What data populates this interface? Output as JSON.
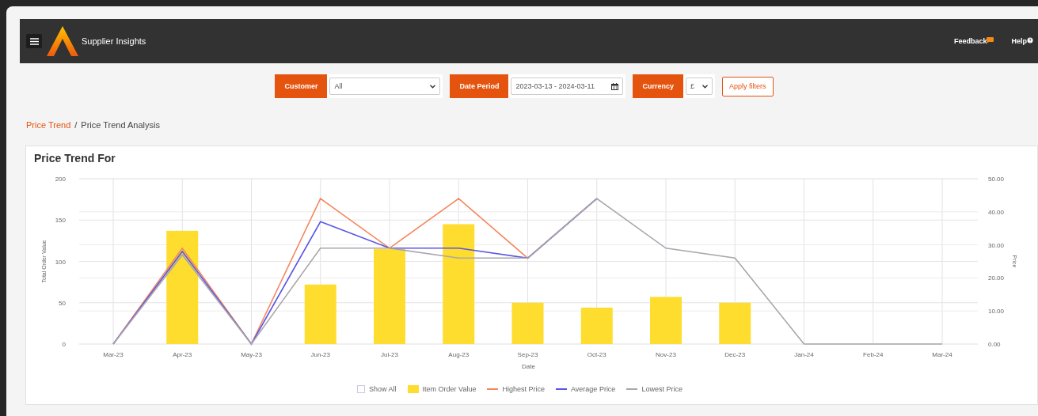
{
  "header": {
    "title": "Supplier Insights",
    "links": [
      {
        "label": "Feedback",
        "kind": "feedback"
      },
      {
        "label": "Help",
        "kind": "help"
      }
    ]
  },
  "filters": [
    {
      "label": "Customer",
      "kind": "select",
      "value": "All"
    },
    {
      "label": "Date Period",
      "kind": "date",
      "value": "2023-03-13 - 2024-03-11"
    },
    {
      "label": "Currency",
      "kind": "select",
      "value": "£"
    }
  ],
  "apply_button": "Apply filters",
  "breadcrumb": {
    "separator": "/",
    "items": [
      {
        "label": "Price Trend",
        "kind": "link"
      },
      {
        "label": "Price Trend Analysis",
        "kind": "current"
      }
    ]
  },
  "card": {
    "title": "Price Trend For",
    "show_all": {
      "label": "Show All",
      "checked": false
    },
    "chart_data": {
      "type": "bar",
      "xlabel": "Date",
      "ylabel": "Total Order Value",
      "y2label": "Price",
      "categories": [
        "Mar-23",
        "Apr-23",
        "May-23",
        "Jun-23",
        "Jul-23",
        "Aug-23",
        "Sep-23",
        "Oct-23",
        "Nov-23",
        "Dec-23",
        "Jan-24",
        "Feb-24",
        "Mar-24"
      ],
      "grid": true,
      "ylim": [
        0,
        200
      ],
      "yticks": [
        0,
        50,
        100,
        150,
        200
      ],
      "y2lim": [
        0,
        50
      ],
      "y2ticks": [
        {
          "value": 0,
          "label": "0.00"
        },
        {
          "value": 10,
          "label": "10.00"
        },
        {
          "value": 20,
          "label": "20.00"
        },
        {
          "value": 30,
          "label": "30.00"
        },
        {
          "value": 40,
          "label": "40.00"
        },
        {
          "value": 50,
          "label": "50.00"
        }
      ],
      "series": [
        {
          "name": "Item Order Value",
          "color": "#fedd2f",
          "values": [
            null,
            137,
            null,
            72,
            115,
            145,
            50,
            44,
            57,
            50,
            null,
            null,
            null
          ]
        },
        {
          "name": "Highest Price",
          "type": "line",
          "axis": "y2",
          "color": "#f5875c",
          "values": [
            0,
            29,
            0,
            44,
            29,
            44,
            26,
            44,
            null,
            null,
            null,
            null,
            null
          ]
        },
        {
          "name": "Average Price",
          "type": "line",
          "axis": "y2",
          "color": "#5a55e6",
          "values": [
            0,
            28,
            0,
            37,
            29,
            29,
            26,
            44,
            null,
            null,
            null,
            null,
            null
          ]
        },
        {
          "name": "Lowest Price",
          "type": "line",
          "axis": "y2",
          "color": "#a9a6ad",
          "values": [
            0,
            27,
            0,
            29,
            29,
            26,
            26,
            44,
            29,
            26,
            0,
            0,
            0
          ]
        }
      ]
    }
  }
}
